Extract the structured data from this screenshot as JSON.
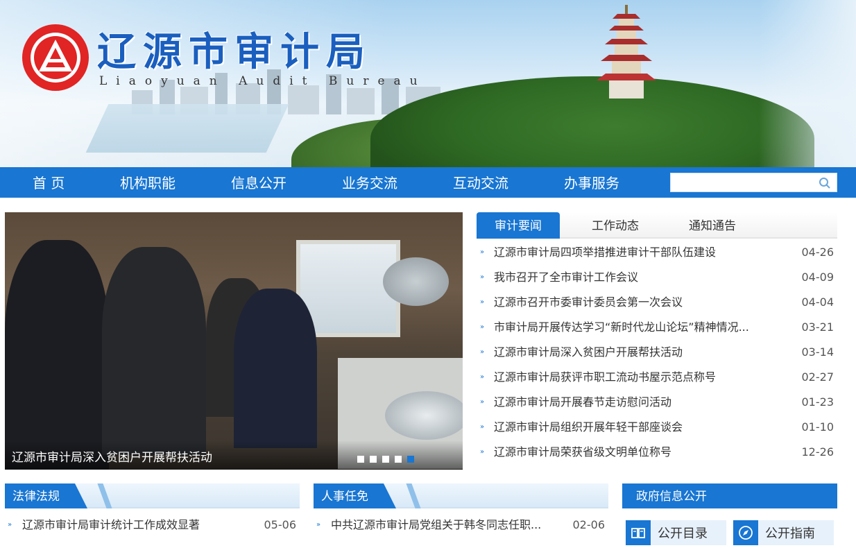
{
  "header": {
    "title": "辽源市审计局",
    "subtitle": "Liaoyuan Audit Bureau"
  },
  "nav": {
    "items": [
      "首 页",
      "机构职能",
      "信息公开",
      "业务交流",
      "互动交流",
      "办事服务"
    ],
    "search_placeholder": ""
  },
  "slider": {
    "caption": "辽源市审计局深入贫困户开展帮扶活动",
    "dots_count": 5,
    "active_dot_index": 4
  },
  "news": {
    "tabs": [
      "审计要闻",
      "工作动态",
      "通知通告"
    ],
    "active_tab": 0,
    "items": [
      {
        "title": "辽源市审计局四项举措推进审计干部队伍建设",
        "date": "04-26"
      },
      {
        "title": "我市召开了全市审计工作会议",
        "date": "04-09"
      },
      {
        "title": "辽源市召开市委审计委员会第一次会议",
        "date": "04-04"
      },
      {
        "title": "市审计局开展传达学习“新时代龙山论坛”精神情况...",
        "date": "03-21"
      },
      {
        "title": "辽源市审计局深入贫困户开展帮扶活动",
        "date": "03-14"
      },
      {
        "title": "辽源市审计局获评市职工流动书屋示范点称号",
        "date": "02-27"
      },
      {
        "title": "辽源市审计局开展春节走访慰问活动",
        "date": "01-23"
      },
      {
        "title": "辽源市审计局组织开展年轻干部座谈会",
        "date": "01-10"
      },
      {
        "title": "辽源市审计局荣获省级文明单位称号",
        "date": "12-26"
      }
    ]
  },
  "laws": {
    "title": "法律法规",
    "items": [
      {
        "title": "辽源市审计局审计统计工作成效显著",
        "date": "05-06"
      }
    ]
  },
  "personnel": {
    "title": "人事任免",
    "items": [
      {
        "title": "中共辽源市审计局党组关于韩冬同志任职...",
        "date": "02-06"
      }
    ]
  },
  "gov_info": {
    "title": "政府信息公开",
    "buttons": [
      {
        "label": "公开目录",
        "icon": "book-icon"
      },
      {
        "label": "公开指南",
        "icon": "compass-icon"
      }
    ]
  },
  "colors": {
    "primary": "#1976d2",
    "logo_red": "#e12424",
    "title_blue": "#1a5fbf"
  }
}
